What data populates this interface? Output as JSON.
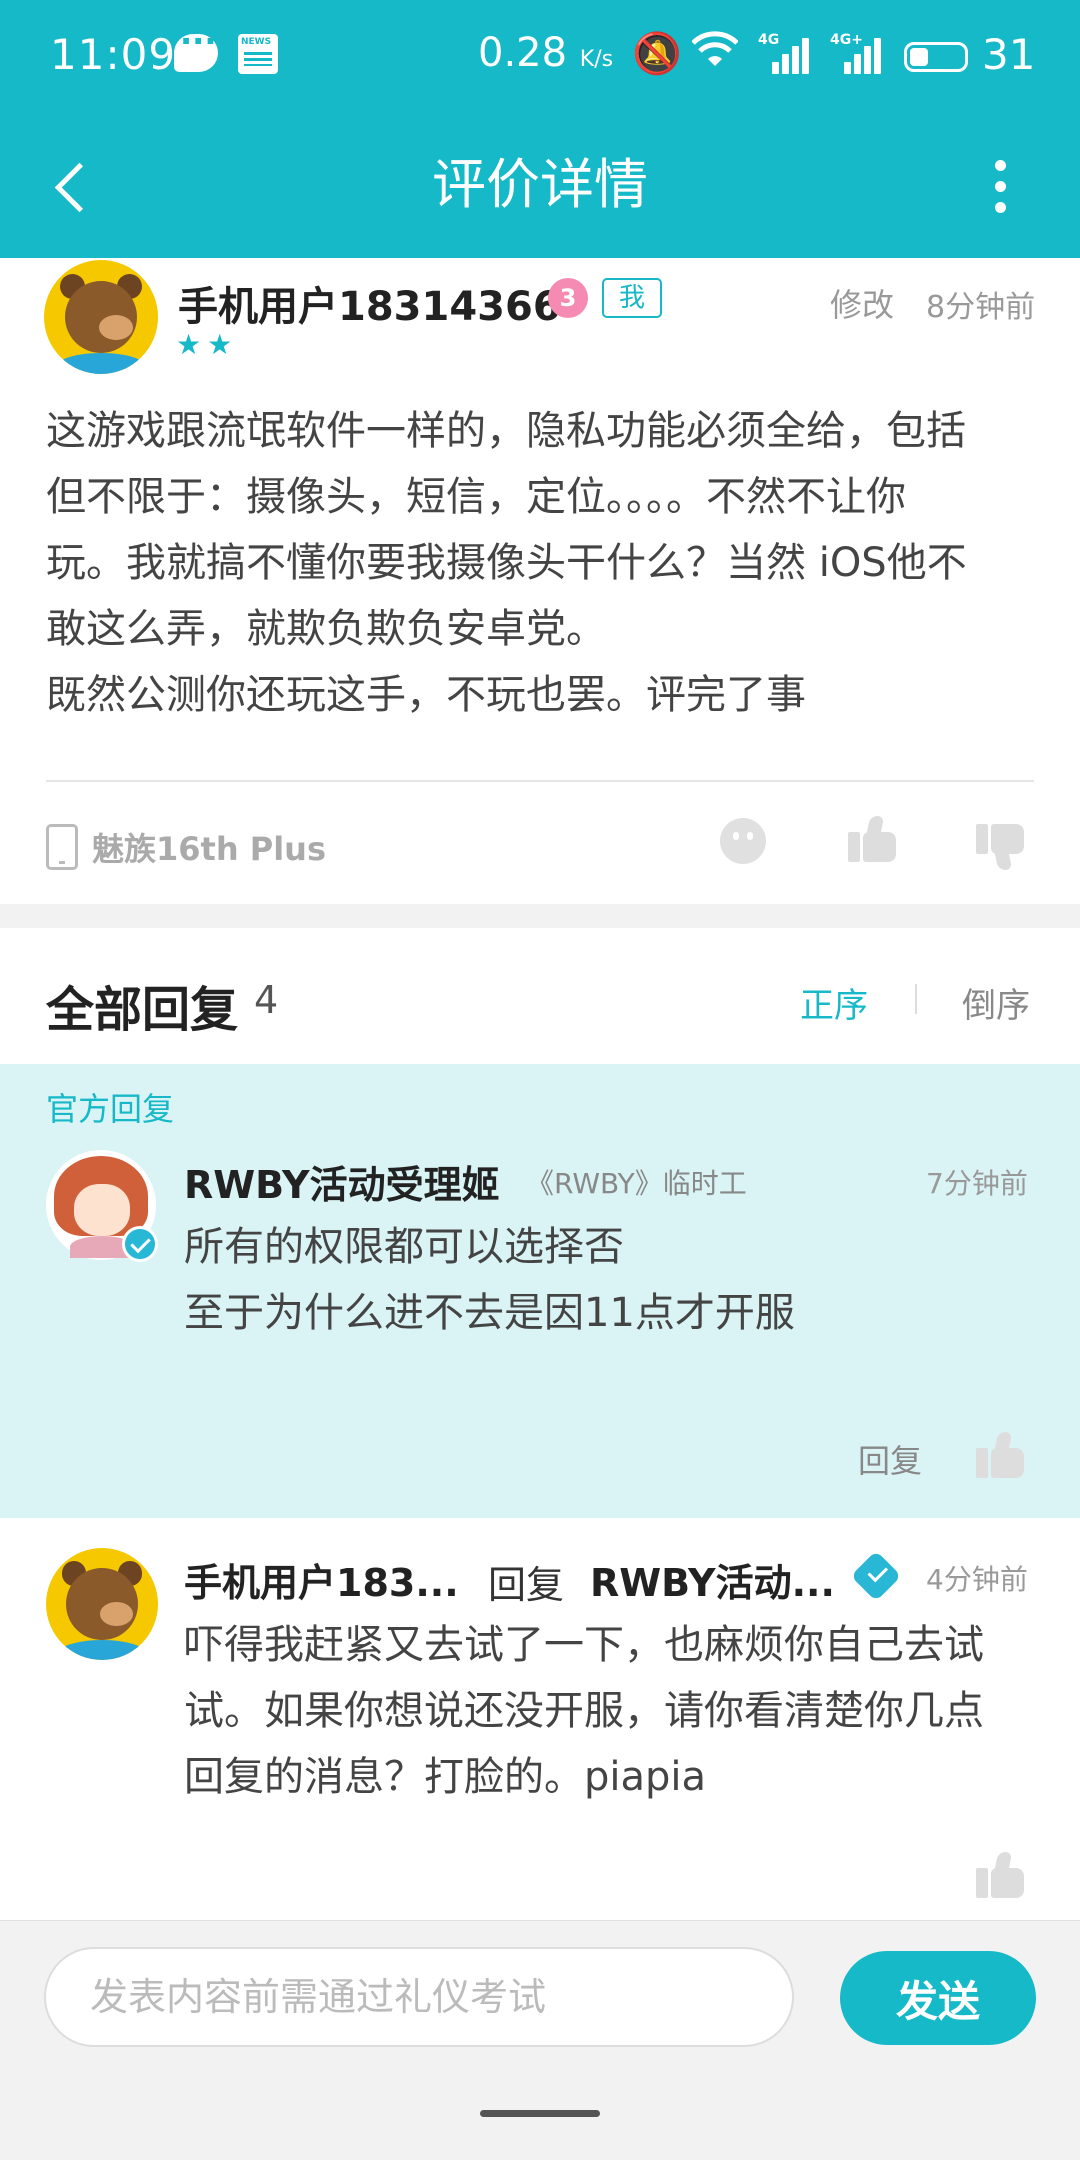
{
  "status_bar": {
    "time": "11:09",
    "net_speed": "0.28",
    "net_unit": "K/s",
    "battery": "31",
    "sim1": "4G",
    "sim2": "4G+"
  },
  "nav": {
    "title": "评价详情"
  },
  "review": {
    "author": "手机用户18314366",
    "level": "3",
    "me_tag": "我",
    "stars": "★★",
    "edit": "修改",
    "time": "8分钟前",
    "lines": [
      "这游戏跟流氓软件一样的，隐私功能必须全给，包括",
      "但不限于：摄像头，短信，定位。。。。不然不让你",
      "玩。我就搞不懂你要我摄像头干什么？当然 iOS他不",
      "敢这么弄，就欺负欺负安卓党。",
      "既然公测你还玩这手，不玩也罢。评完了事"
    ],
    "device": "魅族16th Plus"
  },
  "replies_header": {
    "title": "全部回复",
    "count": "4",
    "sort_asc": "正序",
    "sort_desc": "倒序"
  },
  "official_reply": {
    "label": "官方回复",
    "name": "RWBY活动受理姬",
    "role": "《RWBY》临时工",
    "time": "7分钟前",
    "lines": [
      "所有的权限都可以选择否",
      "至于为什么进不去是因11点才开服"
    ],
    "reply_btn": "回复"
  },
  "user_reply": {
    "name": "手机用户183...",
    "reply_word": "回复",
    "target": "RWBY活动...",
    "time": "4分钟前",
    "lines": [
      "吓得我赶紧又去试了一下，也麻烦你自己去试",
      "试。如果你想说还没开服，请你看清楚你几点",
      "回复的消息？打脸的。piapia"
    ]
  },
  "input_bar": {
    "placeholder": "发表内容前需通过礼仪考试",
    "send": "发送"
  },
  "colors": {
    "accent": "#16b9c8",
    "official_bg": "#daf4f6"
  }
}
